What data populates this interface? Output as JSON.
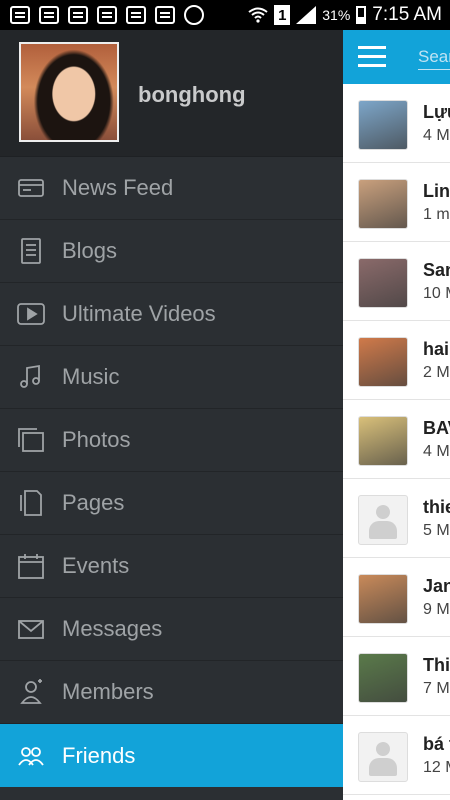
{
  "status_bar": {
    "battery_text": "31%",
    "time": "7:15 AM",
    "sim_label": "1"
  },
  "profile": {
    "username": "bonghong"
  },
  "menu": [
    {
      "label": "News Feed",
      "icon": "news-feed-icon",
      "active": false
    },
    {
      "label": "Blogs",
      "icon": "blog-icon",
      "active": false
    },
    {
      "label": "Ultimate Videos",
      "icon": "video-play-icon",
      "active": false
    },
    {
      "label": "Music",
      "icon": "music-note-icon",
      "active": false
    },
    {
      "label": "Photos",
      "icon": "photos-icon",
      "active": false
    },
    {
      "label": "Pages",
      "icon": "pages-icon",
      "active": false
    },
    {
      "label": "Events",
      "icon": "calendar-icon",
      "active": false
    },
    {
      "label": "Messages",
      "icon": "envelope-icon",
      "active": false
    },
    {
      "label": "Members",
      "icon": "member-icon",
      "active": false
    },
    {
      "label": "Friends",
      "icon": "friends-icon",
      "active": true
    }
  ],
  "topbar": {
    "search_placeholder": "Sear"
  },
  "friends": [
    {
      "name": "Lựu",
      "sub": "4 M",
      "avatar_color": "#7da6c9"
    },
    {
      "name": "Linh",
      "sub": "1 m",
      "avatar_color": "#c9a07d"
    },
    {
      "name": "San",
      "sub": "10 M",
      "avatar_color": "#8a6a6a"
    },
    {
      "name": "hai",
      "sub": "2 M",
      "avatar_color": "#d07a4a"
    },
    {
      "name": "BAV",
      "sub": "4 M",
      "avatar_color": "#d9c07a"
    },
    {
      "name": "thie",
      "sub": "5 M",
      "avatar_color": "default"
    },
    {
      "name": "Jan",
      "sub": "9 M",
      "avatar_color": "#c98a5a"
    },
    {
      "name": "Thi",
      "sub": "7 M",
      "avatar_color": "#5a7a4a"
    },
    {
      "name": "bá t",
      "sub": "12 M",
      "avatar_color": "default"
    }
  ],
  "colors": {
    "accent": "#12a3d9",
    "drawer_bg": "#2b2f33"
  }
}
